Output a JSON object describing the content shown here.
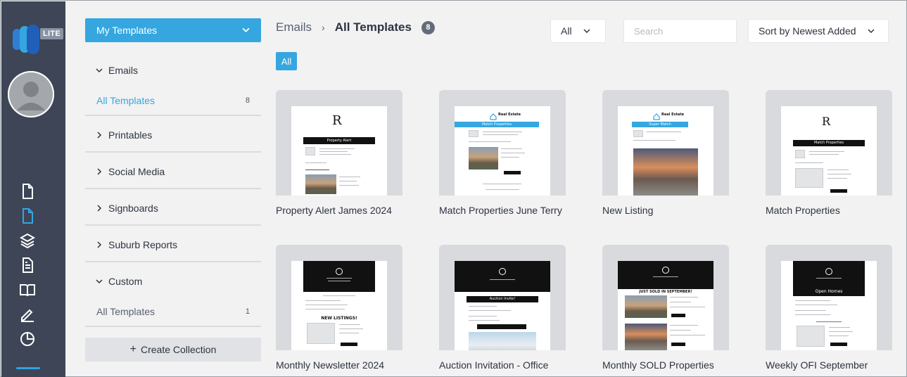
{
  "rail": {
    "badge": "LITE",
    "icons": [
      "file-icon",
      "file-active-icon",
      "layers-icon",
      "document-lines-icon",
      "book-open-icon",
      "pen-icon",
      "pie-chart-icon"
    ]
  },
  "panel": {
    "collection_select": "My Templates",
    "sections": [
      {
        "label": "Emails",
        "expanded": true
      },
      {
        "label": "Printables",
        "expanded": false
      },
      {
        "label": "Social Media",
        "expanded": false
      },
      {
        "label": "Signboards",
        "expanded": false
      },
      {
        "label": "Suburb Reports",
        "expanded": false
      },
      {
        "label": "Custom",
        "expanded": true
      }
    ],
    "emails_all": {
      "label": "All Templates",
      "count": "8"
    },
    "custom_all": {
      "label": "All Templates",
      "count": "1"
    },
    "create_label": "Create Collection"
  },
  "header": {
    "crumb_root": "Emails",
    "crumb_current": "All Templates",
    "count": "8",
    "filter_value": "All",
    "search_placeholder": "Search",
    "sort_value": "Sort by Newest Added",
    "chip": "All"
  },
  "cards": [
    {
      "title": "Property Alert James 2024",
      "banner": "Property Alert"
    },
    {
      "title": "Match Properties June Terry",
      "banner": "Match Properties"
    },
    {
      "title": "New Listing",
      "banner": "Super Match"
    },
    {
      "title": "Match Properties",
      "banner": "Match Properties"
    },
    {
      "title": "Monthly Newsletter 2024",
      "banner": "NEW LISTINGS!"
    },
    {
      "title": "Auction Invitation - Office",
      "banner": "Auction Invite!"
    },
    {
      "title": "Monthly SOLD Properties",
      "banner": "JUST SOLD IN SEPTEMBER!"
    },
    {
      "title": "Weekly OFI September",
      "banner": "Open Homes"
    }
  ],
  "colors": {
    "accent": "#35a6e0",
    "rail": "#3d4556"
  }
}
